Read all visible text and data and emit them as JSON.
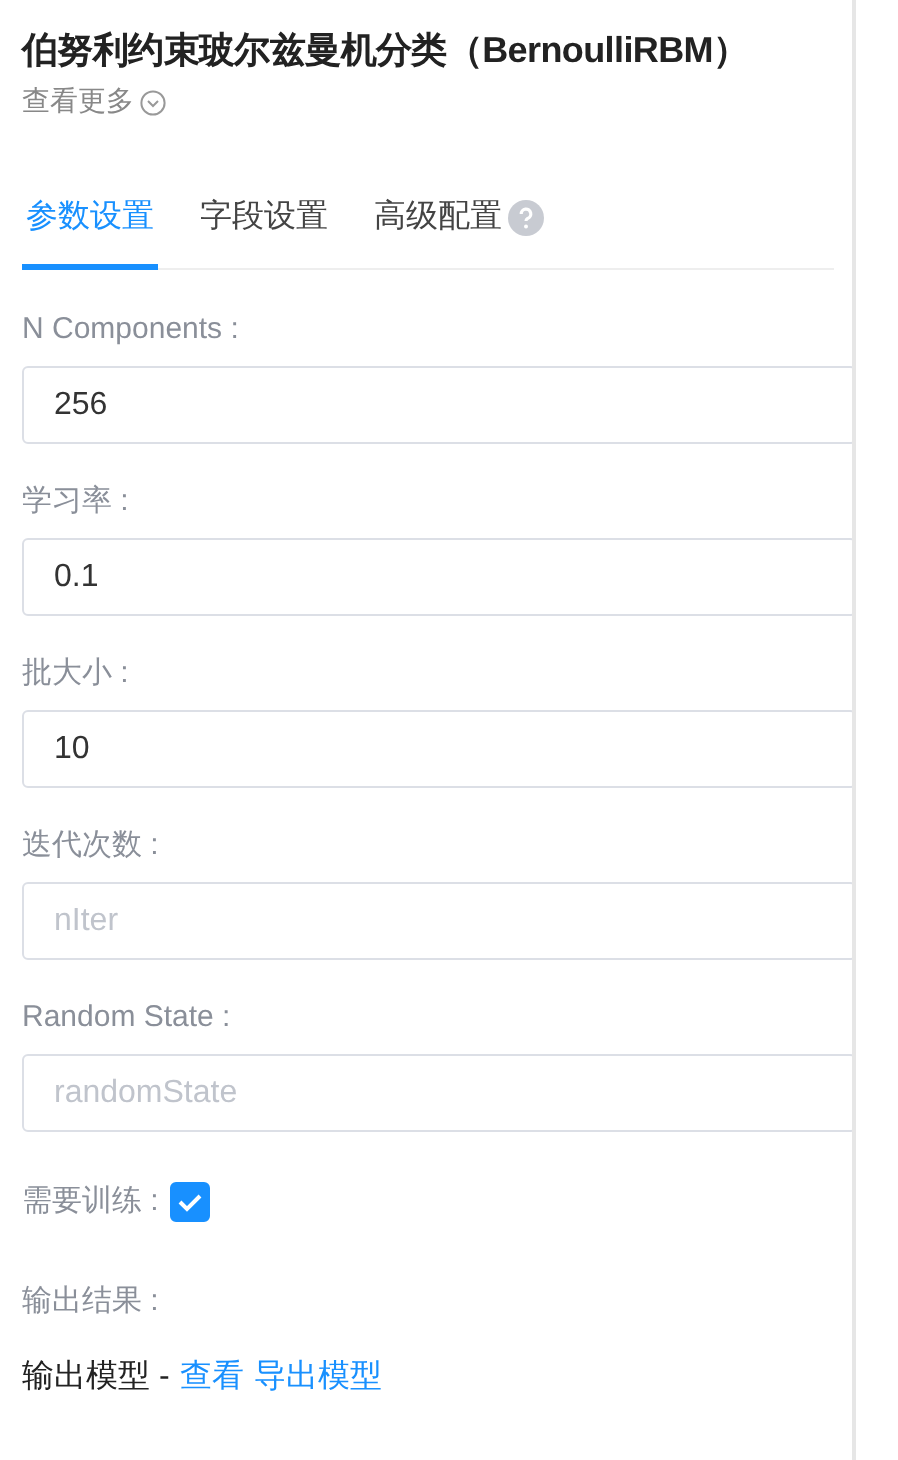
{
  "header": {
    "title": "伯努利约束玻尔兹曼机分类（BernoulliRBM）",
    "more_link": "查看更多"
  },
  "tabs": [
    {
      "label": "参数设置",
      "selected": true,
      "help": false
    },
    {
      "label": "字段设置",
      "selected": false,
      "help": false
    },
    {
      "label": "高级配置",
      "selected": false,
      "help": true
    }
  ],
  "fields": [
    {
      "kind": "input",
      "label": "N Components :",
      "value": "256"
    },
    {
      "kind": "input",
      "label": "学习率 :",
      "value": "0.1"
    },
    {
      "kind": "input",
      "label": "批大小 :",
      "value": "10"
    },
    {
      "kind": "input",
      "label": "迭代次数 :",
      "placeholder": "nIter"
    },
    {
      "kind": "input",
      "label": "Random State :",
      "placeholder": "randomState"
    },
    {
      "kind": "checkbox",
      "label": "需要训练 :",
      "checked": true
    }
  ],
  "output": {
    "label": "输出结果 :",
    "items": [
      {
        "name": "输出模型 -",
        "links": [
          "查看",
          "导出模型"
        ]
      }
    ]
  }
}
